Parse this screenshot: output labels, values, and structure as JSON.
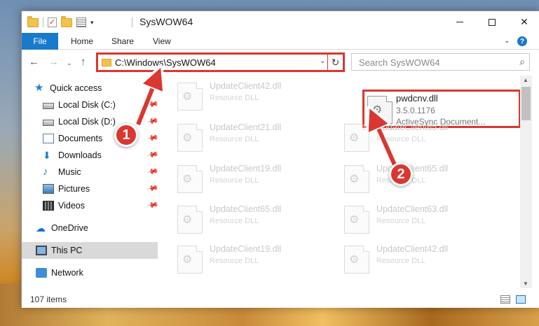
{
  "window": {
    "title": "SysWOW64",
    "controls": {
      "minimize": "–",
      "maximize": "□",
      "close": "✕"
    }
  },
  "ribbon": {
    "tabs": [
      "File",
      "Home",
      "Share",
      "View"
    ],
    "expand_icon": "chevron-down-icon",
    "help": "?"
  },
  "address": {
    "path": "C:\\Windows\\SysWOW64",
    "search_placeholder": "Search SysWOW64"
  },
  "nav": {
    "items": [
      {
        "label": "Quick access",
        "icon": "star-icon",
        "pinned": false
      },
      {
        "label": "Local Disk (C:)",
        "icon": "drive-icon",
        "pinned": true
      },
      {
        "label": "Local Disk (D:)",
        "icon": "drive-icon",
        "pinned": true
      },
      {
        "label": "Documents",
        "icon": "documents-icon",
        "pinned": true
      },
      {
        "label": "Downloads",
        "icon": "downloads-icon",
        "pinned": true
      },
      {
        "label": "Music",
        "icon": "music-icon",
        "pinned": true
      },
      {
        "label": "Pictures",
        "icon": "pictures-icon",
        "pinned": true
      },
      {
        "label": "Videos",
        "icon": "videos-icon",
        "pinned": true
      },
      {
        "label": "OneDrive",
        "icon": "onedrive-icon",
        "pinned": false
      },
      {
        "label": "This PC",
        "icon": "this-pc-icon",
        "pinned": false,
        "selected": true
      },
      {
        "label": "Network",
        "icon": "network-icon",
        "pinned": false
      }
    ]
  },
  "files": {
    "left_column": [
      {
        "name": "UpdateClient42.dll",
        "desc": "Resource DLL"
      },
      {
        "name": "UpdateClient21.dll",
        "desc": "Resource DLL"
      },
      {
        "name": "UpdateClient19.dll",
        "desc": "Resource DLL"
      },
      {
        "name": "UpdateClient65.dll",
        "desc": "Resource DLL"
      },
      {
        "name": "UpdateClient19.dll",
        "desc": "Resource DLL"
      }
    ],
    "right_column": [
      {
        "name": "pwdcnv.dll",
        "version": "3.5.0.1176",
        "desc": "ActiveSync Document...",
        "highlighted": true
      },
      {
        "name": "UpdateClient65.dll",
        "desc": "Resource DLL"
      },
      {
        "name": "UpdateClient65.dll",
        "desc": "Resource DLL"
      },
      {
        "name": "UpdateClient63.dll",
        "desc": "Resource DLL"
      },
      {
        "name": "UpdateClient42.dll",
        "desc": "Resource DLL"
      }
    ]
  },
  "status": {
    "item_count": "107 items"
  },
  "callouts": {
    "one": "1",
    "two": "2"
  },
  "colors": {
    "accent": "#1979ca",
    "highlight_red": "#d9372f"
  }
}
